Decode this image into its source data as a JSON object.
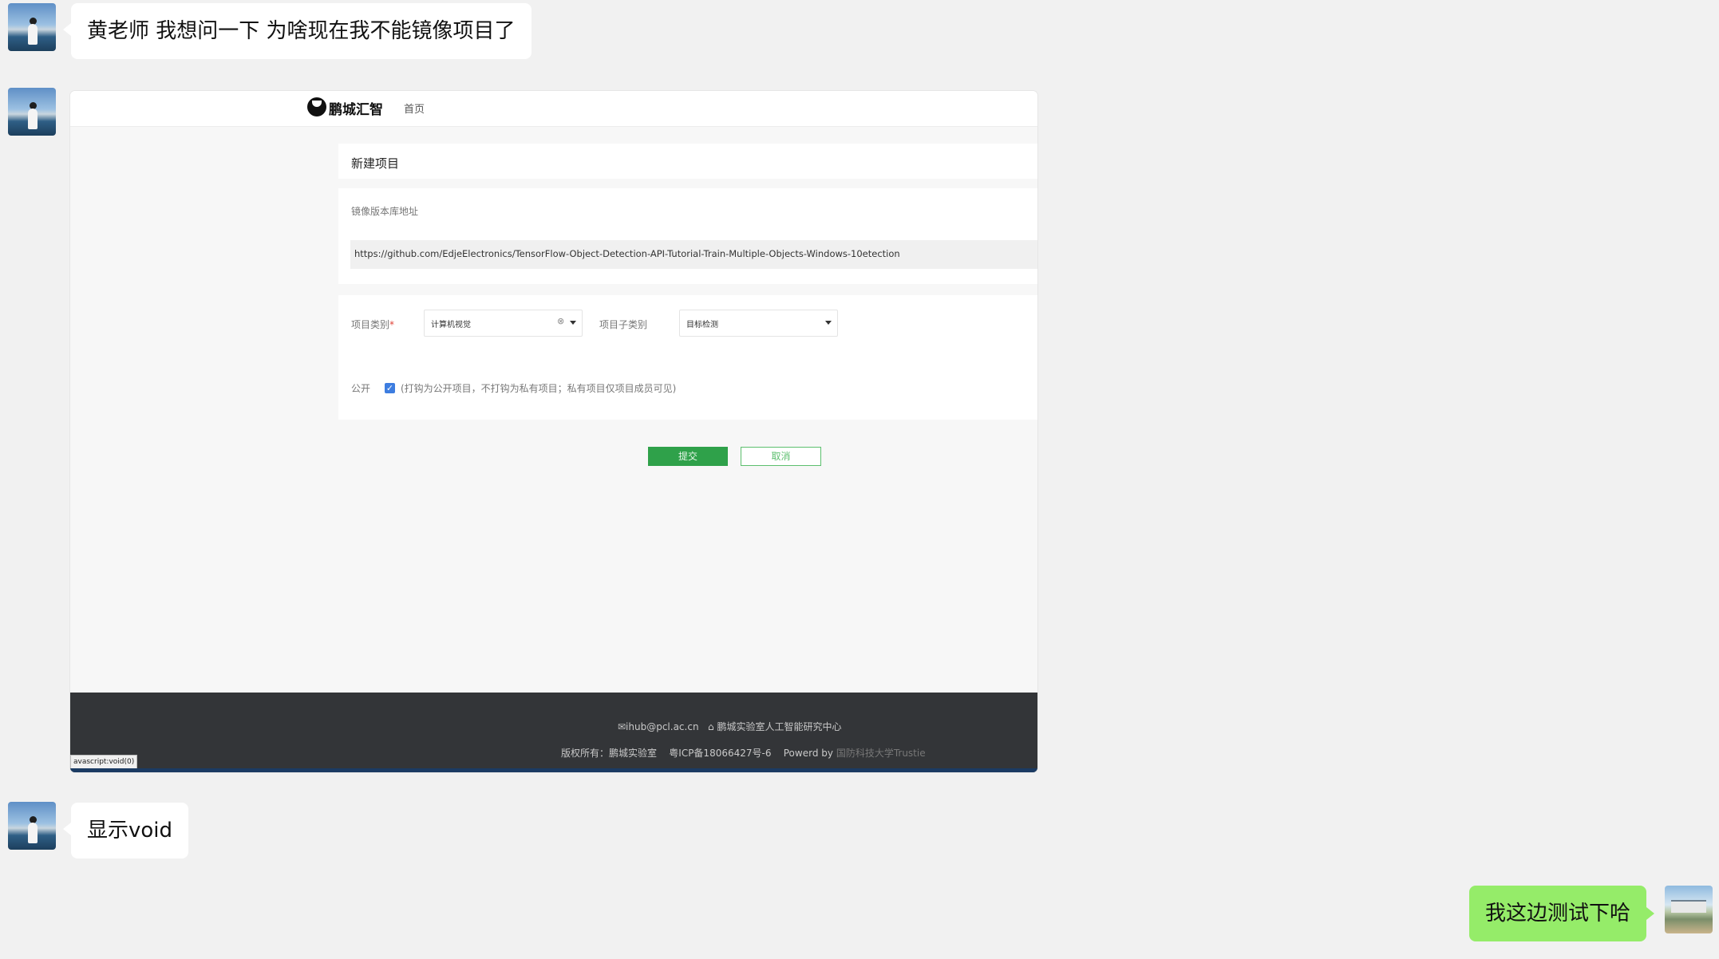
{
  "chat": {
    "msg1": "黄老师 我想问一下 为啥现在我不能镜像项目了",
    "msg3": "显示void",
    "msg4": "我这边测试下哈"
  },
  "screenshot": {
    "brand": "鹏城汇智",
    "nav_home": "首页",
    "form_title": "新建项目",
    "repo_label": "镜像版本库地址",
    "repo_url": "https://github.com/EdjeElectronics/TensorFlow-Object-Detection-API-Tutorial-Train-Multiple-Objects-Windows-10etection",
    "category_label": "项目类别",
    "category_required": "*",
    "category_value": "计算机视觉",
    "subcategory_label": "项目子类别",
    "subcategory_value": "目标检测",
    "public_label": "公开",
    "public_hint": "(打钩为公开项目，不打钩为私有项目；私有项目仅项目成员可见)",
    "submit_label": "提交",
    "cancel_label": "取消",
    "footer_email": "✉ihub@pcl.ac.cn",
    "footer_org": "鹏城实验室人工智能研究中心",
    "footer_copyright": "版权所有：鹏城实验室",
    "footer_icp": "粤ICP备18066427号-6",
    "footer_powered": "Powerd by",
    "footer_powered_link": "国防科技大学Trustie",
    "status_text": "avascript:void(0)"
  },
  "colors": {
    "sent_bubble": "#95ec69",
    "submit_button": "#2fa14a",
    "checkbox": "#3d7de0",
    "footer_bg": "#333538"
  }
}
